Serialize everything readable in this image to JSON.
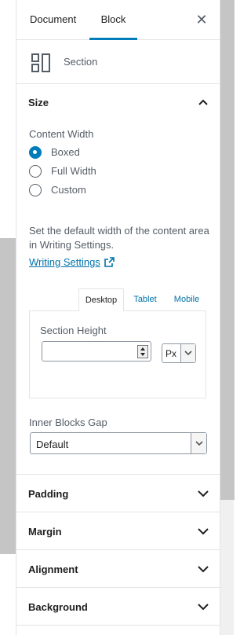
{
  "tabs": {
    "document": "Document",
    "block": "Block"
  },
  "block_card": {
    "name": "Section"
  },
  "size": {
    "title": "Size",
    "content_width_label": "Content Width",
    "options": [
      "Boxed",
      "Full Width",
      "Custom"
    ],
    "selected": "Boxed",
    "help_text": "Set the default width of the content area in Writing Settings.",
    "link_text": "Writing Settings",
    "responsive_tabs": [
      "Desktop",
      "Tablet",
      "Mobile"
    ],
    "active_responsive_tab": "Desktop",
    "section_height_label": "Section Height",
    "section_height_value": "",
    "unit": "Px",
    "inner_gap_label": "Inner Blocks Gap",
    "inner_gap_value": "Default"
  },
  "panels": [
    "Padding",
    "Margin",
    "Alignment",
    "Background"
  ],
  "colors": {
    "accent": "#007cba",
    "link": "#0073aa"
  },
  "icons": {
    "close": "close-icon",
    "block": "section-block-icon",
    "expanded": "chevron-up-icon",
    "collapsed": "chevron-down-icon",
    "external": "external-link-icon"
  }
}
